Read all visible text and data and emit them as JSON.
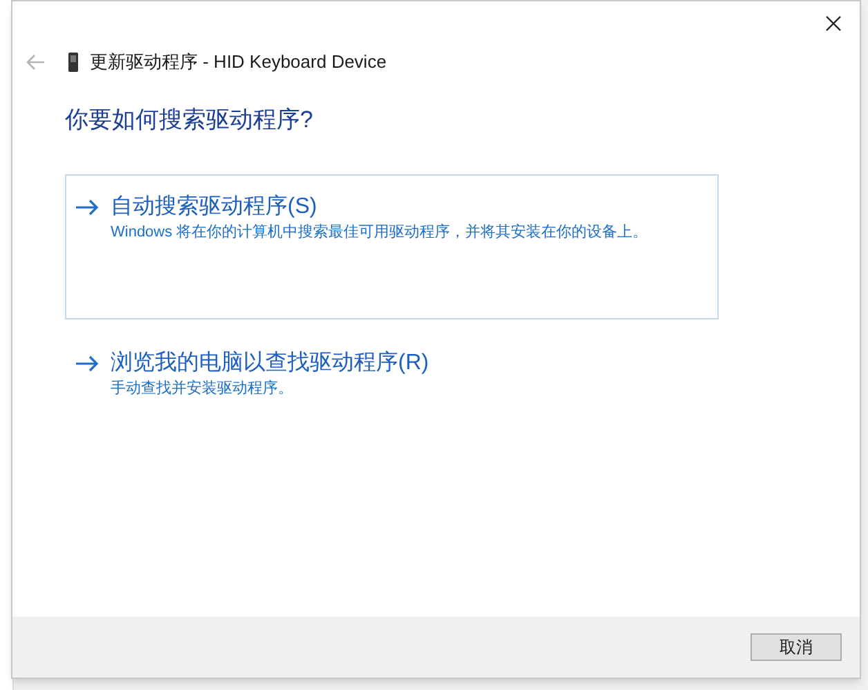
{
  "window": {
    "title": "更新驱动程序 - HID Keyboard Device"
  },
  "heading": "你要如何搜索驱动程序?",
  "options": [
    {
      "title": "自动搜索驱动程序(S)",
      "description": "Windows 将在你的计算机中搜索最佳可用驱动程序，并将其安装在你的设备上。",
      "selected": true
    },
    {
      "title": "浏览我的电脑以查找驱动程序(R)",
      "description": "手动查找并安装驱动程序。",
      "selected": false
    }
  ],
  "buttons": [
    "取消"
  ]
}
